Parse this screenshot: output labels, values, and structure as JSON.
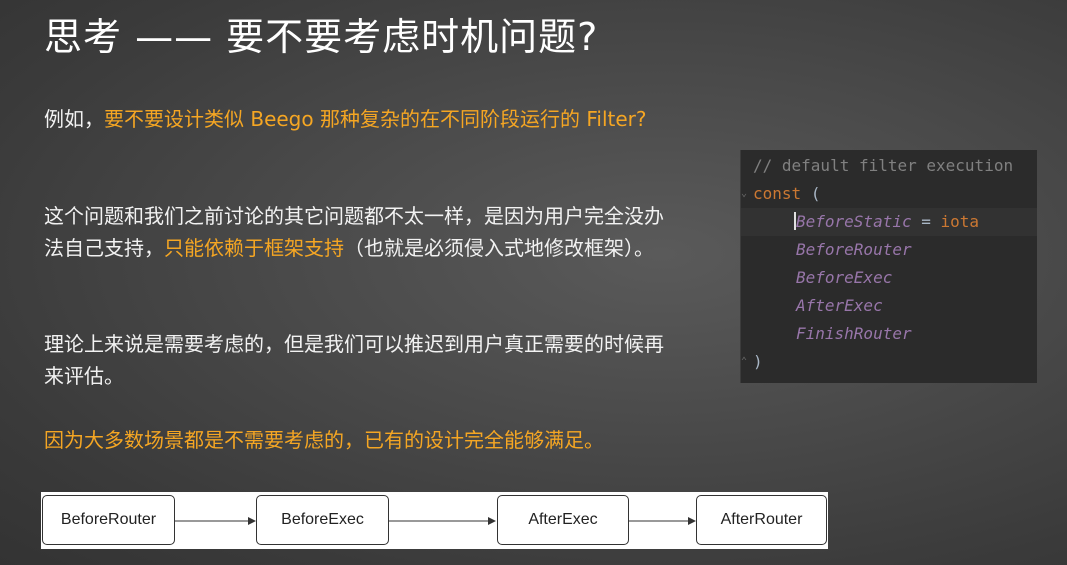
{
  "slide": {
    "title": "思考 —— 要不要考虑时机问题?",
    "p1_prefix": "例如，",
    "p1_highlight": "要不要设计类似 Beego 那种复杂的在不同阶段运行的 Filter?",
    "p2_text": "这个问题和我们之前讨论的其它问题都不太一样，是因为用户完全没办法自己支持，",
    "p2_highlight": "只能依赖于框架支持",
    "p2_suffix": "（也就是必须侵入式地修改框架）。",
    "p3_text": "理论上来说是需要考虑的，但是我们可以推迟到用户真正需要的时候再来评估。",
    "p4_highlight": "因为大多数场景都是不需要考虑的，已有的设计完全能够满足。",
    "highlight_color": "#f5a623"
  },
  "code": {
    "comment": "// default filter execution",
    "keyword": "const",
    "open_paren": "(",
    "close_paren": ")",
    "first_const": "BeforeStatic",
    "assign": " = ",
    "iota": "iota",
    "constants": [
      "BeforeRouter",
      "BeforeExec",
      "AfterExec",
      "FinishRouter"
    ]
  },
  "flow": {
    "nodes": [
      "BeforeRouter",
      "BeforeExec",
      "AfterExec",
      "AfterRouter"
    ]
  }
}
